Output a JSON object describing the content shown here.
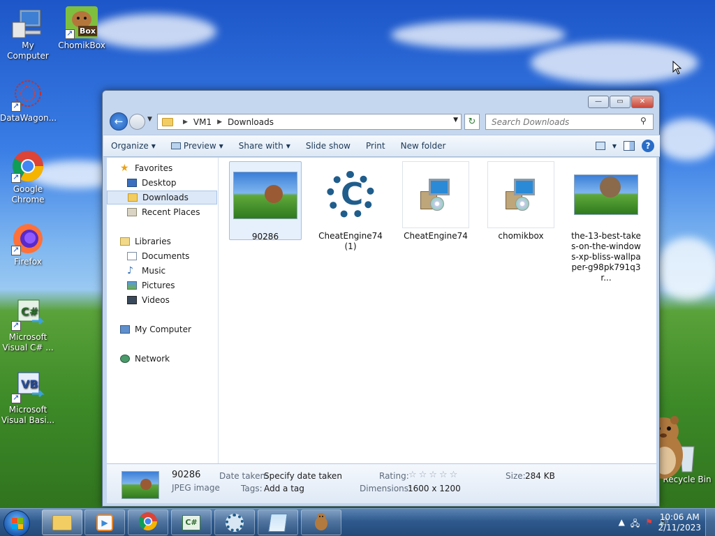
{
  "desktop": {
    "icons": [
      {
        "label": "My Computer"
      },
      {
        "label": "ChomikBox"
      },
      {
        "label": "DataWagon..."
      },
      {
        "label": "Google Chrome"
      },
      {
        "label": "Firefox"
      },
      {
        "label": "Microsoft Visual C# ..."
      },
      {
        "label": "Microsoft Visual Basi..."
      },
      {
        "label": "Recycle Bin"
      }
    ],
    "chomik_badge": "Box"
  },
  "window": {
    "controls": {
      "minimize": "—",
      "maximize": "▭",
      "close": "✕"
    },
    "address": {
      "root": "VM1",
      "current": "Downloads"
    },
    "search_placeholder": "Search Downloads",
    "toolbar": {
      "organize": "Organize",
      "preview": "Preview",
      "share_with": "Share with",
      "slide_show": "Slide show",
      "print": "Print",
      "new_folder": "New folder"
    },
    "nav": {
      "favorites": "Favorites",
      "desktop": "Desktop",
      "downloads": "Downloads",
      "recent_places": "Recent Places",
      "libraries": "Libraries",
      "documents": "Documents",
      "music": "Music",
      "pictures": "Pictures",
      "videos": "Videos",
      "my_computer": "My Computer",
      "network": "Network"
    },
    "files": [
      {
        "name": "90286",
        "type": "image",
        "selected": true
      },
      {
        "name": "CheatEngine74 (1)",
        "type": "cheatengine"
      },
      {
        "name": "CheatEngine74",
        "type": "installer"
      },
      {
        "name": "chomikbox",
        "type": "installer"
      },
      {
        "name": "the-13-best-takes-on-the-windows-xp-bliss-wallpaper-g98pk791q3r...",
        "type": "image"
      }
    ],
    "details": {
      "name": "90286",
      "type": "JPEG image",
      "date_taken_label": "Date taken:",
      "date_taken_value": "Specify date taken",
      "tags_label": "Tags:",
      "tags_value": "Add a tag",
      "rating_label": "Rating:",
      "rating_stars": "☆☆☆☆☆",
      "dimensions_label": "Dimensions:",
      "dimensions_value": "1600 x 1200",
      "size_label": "Size:",
      "size_value": "284 KB"
    }
  },
  "taskbar": {
    "clock_time": "10:06 AM",
    "clock_date": "2/11/2023",
    "buttons": [
      "explorer",
      "media-player",
      "chrome",
      "visual-csharp",
      "cheat-engine",
      "notepad",
      "chomikbox"
    ]
  },
  "colors": {
    "accent": "#1f5d8c",
    "selection": "#dce8f7",
    "taskbar": "#2f5a8e"
  }
}
